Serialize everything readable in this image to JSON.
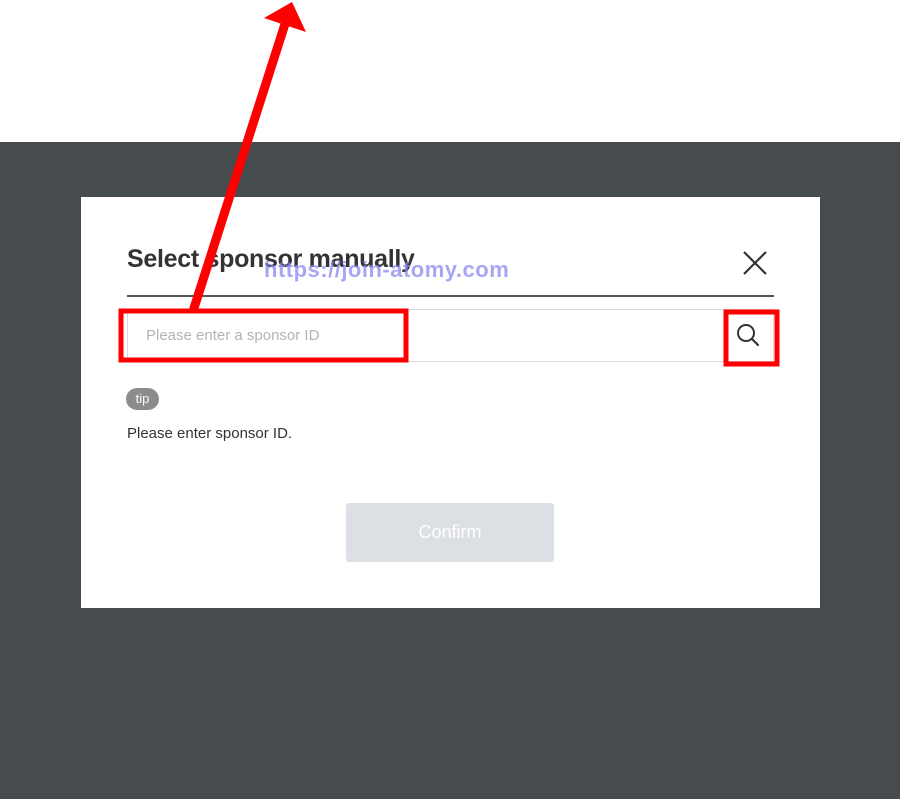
{
  "modal": {
    "title": "Select sponsor manually",
    "search": {
      "placeholder": "Please enter a sponsor ID",
      "value": "",
      "button_icon": "search-icon"
    },
    "close_icon": "close-icon",
    "tip_badge": "tip",
    "tip_text": "Please enter sponsor ID.",
    "confirm_label": "Confirm"
  },
  "watermark": "https://join-atomy.com",
  "colors": {
    "overlay": "#464b4e",
    "modal_bg": "#ffffff",
    "confirm_disabled_bg": "#dcdfe3",
    "tip_badge_bg": "#8c8c8c",
    "annotation_red": "#ff0000",
    "watermark": "#8b87f0"
  }
}
